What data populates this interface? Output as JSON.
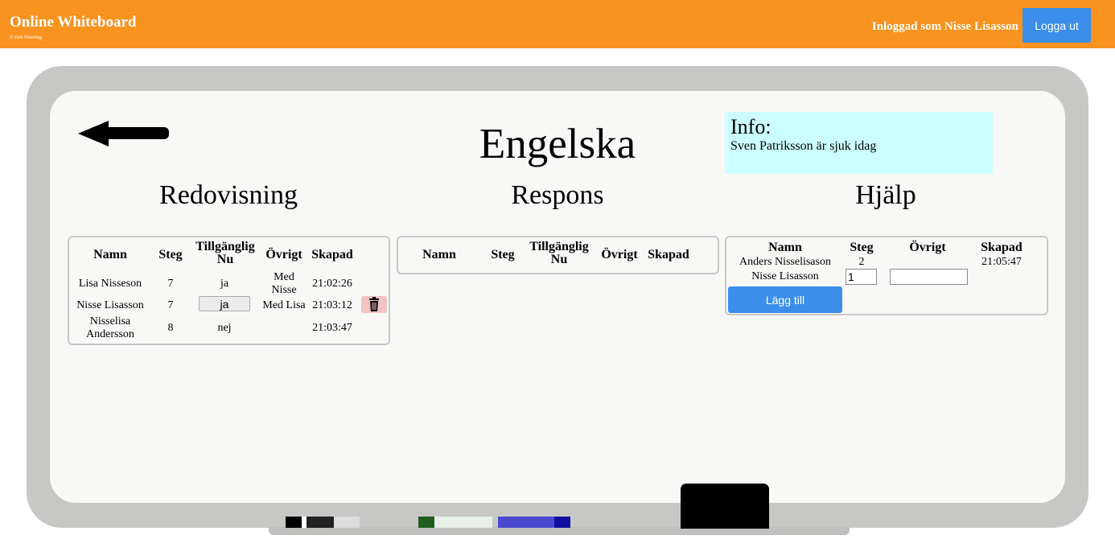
{
  "header": {
    "app_title": "Online Whiteboard",
    "copyright": "© Erik Österling",
    "user_text": "Inloggad som Nisse Lisasson",
    "logout_label": "Logga ut",
    "accent_color": "#f7931e",
    "button_color": "#3b8eea"
  },
  "board": {
    "back_icon": "arrow-left-icon",
    "subject": "Engelska",
    "info": {
      "title": "Info:",
      "text": "Sven Patriksson är sjuk idag",
      "color": "#ccffff"
    }
  },
  "redovisning": {
    "title": "Redovisning",
    "columns": [
      "Namn",
      "Steg",
      "Tillgänglig Nu",
      "Övrigt",
      "Skapad"
    ],
    "rows": [
      {
        "namn": "Lisa Nisseson",
        "steg": "7",
        "tillganglig": "ja",
        "ovrigt": "Med Nisse",
        "skapad": "21:02:26"
      },
      {
        "namn": "Nisse Lisasson",
        "steg": "7",
        "tillganglig": "ja",
        "ovrigt": "Med Lisa",
        "skapad": "21:03:12",
        "delete_icon": "trash-icon"
      },
      {
        "namn": "Nisselisa Andersson",
        "steg": "8",
        "tillganglig": "nej",
        "ovrigt": "",
        "skapad": "21:03:47"
      }
    ]
  },
  "respons": {
    "title": "Respons",
    "columns": [
      "Namn",
      "Steg",
      "Tillgänglig Nu",
      "Övrigt",
      "Skapad"
    ]
  },
  "hjalp": {
    "title": "Hjälp",
    "columns": [
      "Namn",
      "Steg",
      "Övrigt",
      "Skapad"
    ],
    "rows": [
      {
        "namn": "Anders Nisselisason",
        "steg": "2",
        "ovrigt": "",
        "skapad": "21:05:47"
      }
    ],
    "form": {
      "namn": "Nisse Lisasson",
      "steg_value": "1",
      "ovrigt_value": "",
      "add_label": "Lägg till"
    }
  }
}
